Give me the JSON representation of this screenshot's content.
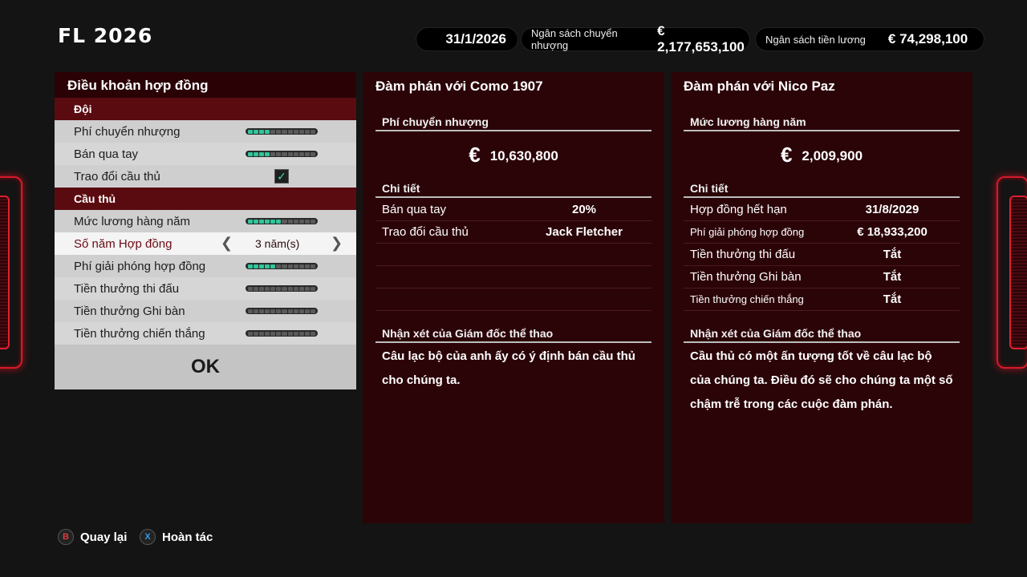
{
  "header": {
    "logo": "FL 2026",
    "date": "31/1/2026",
    "transfer_budget_label": "Ngân sách chuyển nhượng",
    "transfer_budget_value": "€  2,177,653,100",
    "wage_budget_label": "Ngân sách tiền lương",
    "wage_budget_value": "€  74,298,100"
  },
  "contract_terms": {
    "title": "Điều khoản hợp đồng",
    "team_section": "Đội",
    "player_section": "Cầu thủ",
    "rows": [
      {
        "label": "Phí chuyển nhượng",
        "level": 4
      },
      {
        "label": "Bán qua tay",
        "level": 4
      },
      {
        "label": "Trao đổi cầu thủ",
        "checked": true
      },
      {
        "label": "Mức lương hàng năm",
        "level": 6
      },
      {
        "label": "Số năm Hợp đồng",
        "value": "3 năm(s)"
      },
      {
        "label": "Phí giải phóng hợp đồng",
        "level": 5
      },
      {
        "label": "Tiền thưởng thi đấu",
        "level": 0
      },
      {
        "label": "Tiền thưởng Ghi bàn",
        "level": 0
      },
      {
        "label": "Tiền thưởng chiến thắng",
        "level": 0
      }
    ],
    "meter_segments": 12,
    "ok_label": "OK"
  },
  "club_negotiation": {
    "title": "Đàm phán với Como 1907",
    "fee_header": "Phí chuyển nhượng",
    "currency": "€",
    "fee_amount": "10,630,800",
    "details_header": "Chi tiết",
    "details": [
      {
        "key": "Bán qua tay",
        "value": "20%"
      },
      {
        "key": "Trao đổi cầu thủ",
        "value": "Jack Fletcher"
      }
    ],
    "comment_header": "Nhận xét của Giám đốc thể thao",
    "comment_line1": "Câu lạc bộ của anh ấy có ý định bán cầu thủ",
    "comment_line2": "cho chúng ta."
  },
  "player_negotiation": {
    "title": "Đàm phán với Nico Paz",
    "wage_header": "Mức lương hàng năm",
    "currency": "€",
    "wage_amount": "2,009,900",
    "details_header": "Chi tiết",
    "details": [
      {
        "key": "Hợp đồng hết hạn",
        "value": "31/8/2029"
      },
      {
        "key": "Phí giải phóng hợp đồng",
        "value": "€  18,933,200"
      },
      {
        "key": "Tiền thưởng thi đấu",
        "value": "Tắt"
      },
      {
        "key": "Tiền thưởng Ghi bàn",
        "value": "Tắt"
      },
      {
        "key": "Tiền thưởng chiến thắng",
        "value": "Tắt"
      }
    ],
    "comment_header": "Nhận xét của Giám đốc thể thao",
    "comment_line1": "Cầu thủ có một ấn tượng tốt về câu lạc bộ",
    "comment_line2": "của chúng ta. Điều đó sẽ cho chúng ta một số",
    "comment_line3": "chậm trễ trong các cuộc đàm phán."
  },
  "footer": {
    "back_button": "B",
    "back_label": "Quay lại",
    "undo_button": "X",
    "undo_label": "Hoàn tác"
  },
  "colors": {
    "meter_on": "#32c49a",
    "panel_dark_red": "#2b0408",
    "section_red": "#5a0b10",
    "glow_red": "#d61a2a"
  }
}
